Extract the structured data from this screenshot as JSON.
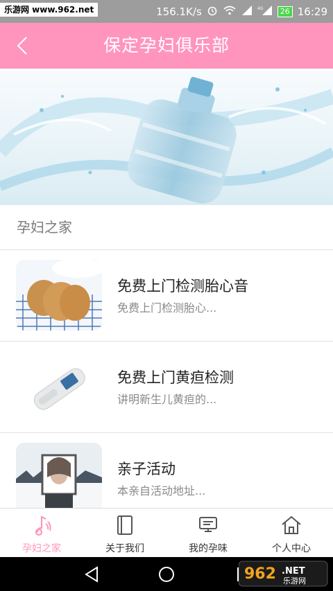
{
  "status_bar": {
    "watermark": "乐游网 www.962.net",
    "speed": "156.1K/s",
    "battery": "26",
    "time": "16:29"
  },
  "header": {
    "title": "保定孕妇俱乐部"
  },
  "section": {
    "title": "孕妇之家"
  },
  "items": [
    {
      "title": "免费上门检测胎心音",
      "subtitle": "免费上门检测胎心..."
    },
    {
      "title": "免费上门黄疸检测",
      "subtitle": "讲明新生儿黄疸的..."
    },
    {
      "title": "亲子活动",
      "subtitle": "本亲自活动地址..."
    }
  ],
  "tabs": [
    {
      "label": "孕妇之家",
      "icon": "music-note-icon",
      "active": true
    },
    {
      "label": "关于我们",
      "icon": "book-icon"
    },
    {
      "label": "我的孕味",
      "icon": "tv-icon"
    },
    {
      "label": "个人中心",
      "icon": "home-icon"
    }
  ],
  "colors": {
    "accent": "#ff95bd",
    "statusbar": "#9d9d9d"
  },
  "logo": {
    "text": "962.NET",
    "subtext": "乐游网"
  }
}
